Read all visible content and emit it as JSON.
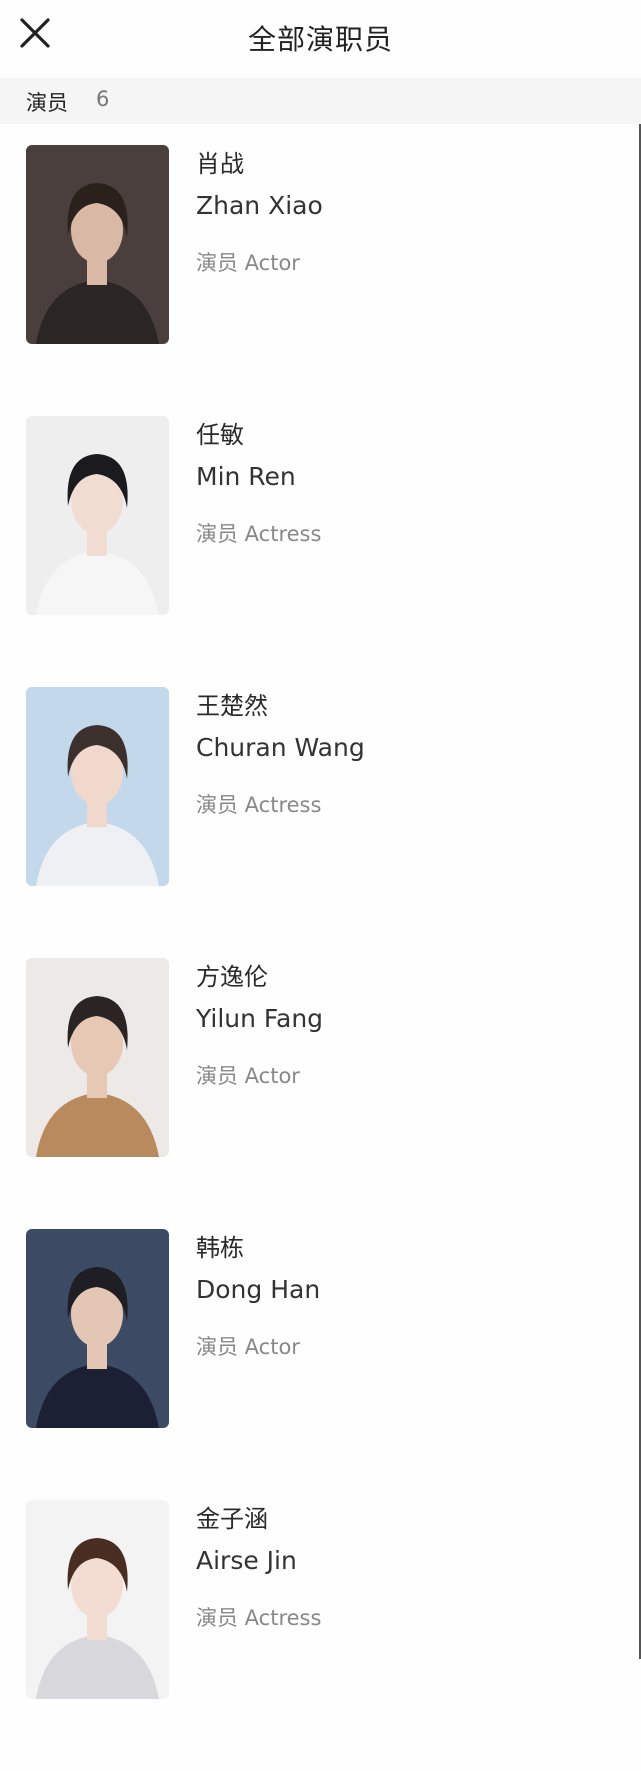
{
  "header": {
    "title": "全部演职员",
    "close_icon": "close-icon"
  },
  "section": {
    "label": "演员",
    "count": "6"
  },
  "cast": [
    {
      "name_cn": "肖战",
      "name_en": "Zhan Xiao",
      "role": "演员 Actor",
      "bg": "#4a3f3c",
      "hair": "#2a201c",
      "skin": "#d9b9a6",
      "cloth": "#2b2624"
    },
    {
      "name_cn": "任敏",
      "name_en": "Min Ren",
      "role": "演员 Actress",
      "bg": "#eeeeee",
      "hair": "#1a1a1f",
      "skin": "#f1dcd2",
      "cloth": "#f6f6f6"
    },
    {
      "name_cn": "王楚然",
      "name_en": "Churan Wang",
      "role": "演员 Actress",
      "bg": "#c3d8ea",
      "hair": "#3b302d",
      "skin": "#f0d8cc",
      "cloth": "#eef0f4"
    },
    {
      "name_cn": "方逸伦",
      "name_en": "Yilun Fang",
      "role": "演员 Actor",
      "bg": "#ece9e6",
      "hair": "#2a2522",
      "skin": "#e6c8b4",
      "cloth": "#b98a5e"
    },
    {
      "name_cn": "韩栋",
      "name_en": "Dong Han",
      "role": "演员 Actor",
      "bg": "#3d4a63",
      "hair": "#1e1e24",
      "skin": "#e3c6b3",
      "cloth": "#1c2035"
    },
    {
      "name_cn": "金子涵",
      "name_en": "Airse Jin",
      "role": "演员 Actress",
      "bg": "#f3f3f3",
      "hair": "#4a2d22",
      "skin": "#f3ddd2",
      "cloth": "#d8d8dc"
    }
  ]
}
